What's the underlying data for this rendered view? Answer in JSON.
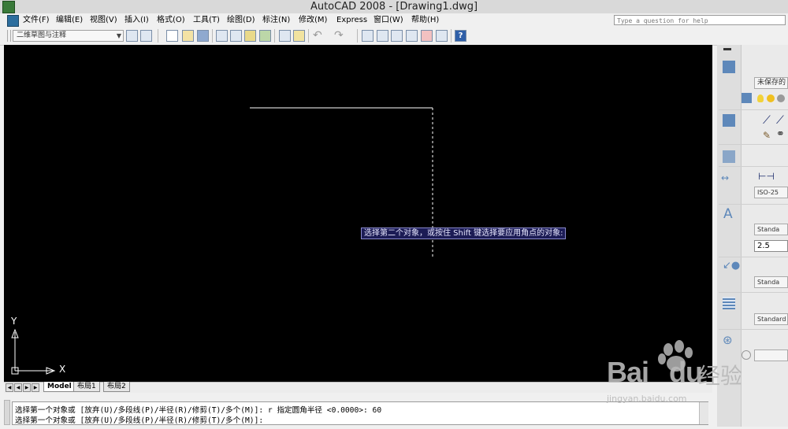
{
  "window": {
    "title": "AutoCAD 2008 - [Drawing1.dwg]"
  },
  "menu": {
    "items": [
      "文件(F)",
      "编辑(E)",
      "视图(V)",
      "插入(I)",
      "格式(O)",
      "工具(T)",
      "绘图(D)",
      "标注(N)",
      "修改(M)",
      "Express",
      "窗口(W)",
      "帮助(H)"
    ],
    "help_placeholder": "Type a question for help"
  },
  "toolbar": {
    "workspace": "二维草图与注释"
  },
  "drawing": {
    "tooltip": "选择第二个对象，或按住 Shift 键选择要应用角点的对象:",
    "ucs_x_label": "X",
    "ucs_y_label": "Y"
  },
  "layout_tabs": [
    "Model",
    "布局1",
    "布局2"
  ],
  "command": {
    "lines": [
      "选择第一个对象或 [放弃(U)/多段线(P)/半径(R)/修剪(T)/多个(M)]: r 指定圆角半径 <0.0000>: 60",
      "选择第一个对象或 [放弃(U)/多段线(P)/半径(R)/修剪(T)/多个(M)]:"
    ]
  },
  "palette": {
    "layer_combo": "未保存的",
    "dim_style": "ISO-25",
    "text_style": "Standa",
    "text_height": "2.5",
    "multileader_style": "Standa",
    "table_style": "Standard"
  },
  "watermark": {
    "brand": "Bai",
    "brand2": "du",
    "chinese": "经验",
    "url": "jingyan.baidu.com"
  },
  "colors": {
    "canvas": "#000000",
    "tooltip_bg": "#1c1c55",
    "watermark": "#b8b8b8"
  }
}
